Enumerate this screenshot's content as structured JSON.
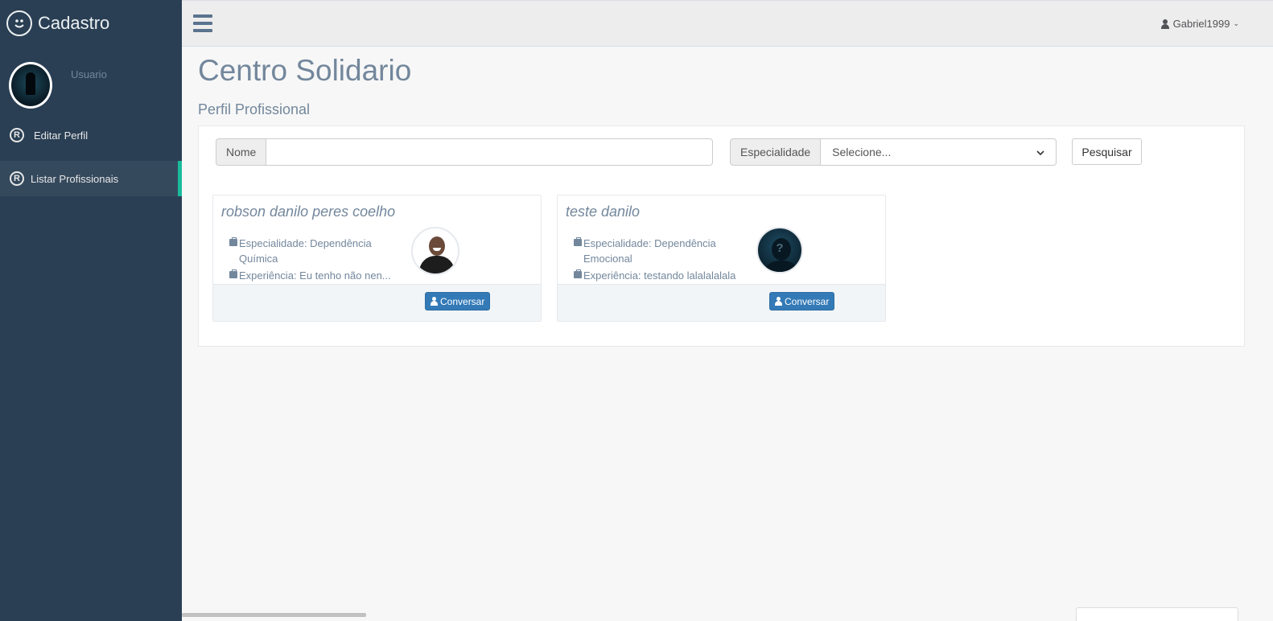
{
  "sidebar": {
    "brand": "Cadastro",
    "brand_icon": "smiley-icon",
    "profile_label": "Usuario",
    "menu": [
      {
        "label": "Editar Perfil",
        "icon": "registered-icon"
      },
      {
        "label": "Listar Profissionais",
        "icon": "registered-icon",
        "active": true
      }
    ]
  },
  "topnav": {
    "username": "Gabriel1999",
    "menu_icon": "hamburger-icon"
  },
  "main": {
    "title": "Centro Solidario",
    "subtitle": "Perfil Profissional"
  },
  "search": {
    "name_label": "Nome",
    "name_value": "",
    "specialty_label": "Especialidade",
    "specialty_selected": "Selecione...",
    "search_button": "Pesquisar"
  },
  "cards": [
    {
      "name": "robson danilo peres coelho",
      "specialty": "Especialidade: Dependência Química",
      "experience": "Experiência: Eu tenho não nen...",
      "button": "Conversar"
    },
    {
      "name": "teste danilo",
      "specialty": "Especialidade: Dependência Emocional",
      "experience": "Experiência: testando lalalalalala",
      "button": "Conversar"
    }
  ],
  "colors": {
    "sidebar": "#2a3f54",
    "accent": "#1abb9c",
    "primary_button": "#337ab7"
  }
}
